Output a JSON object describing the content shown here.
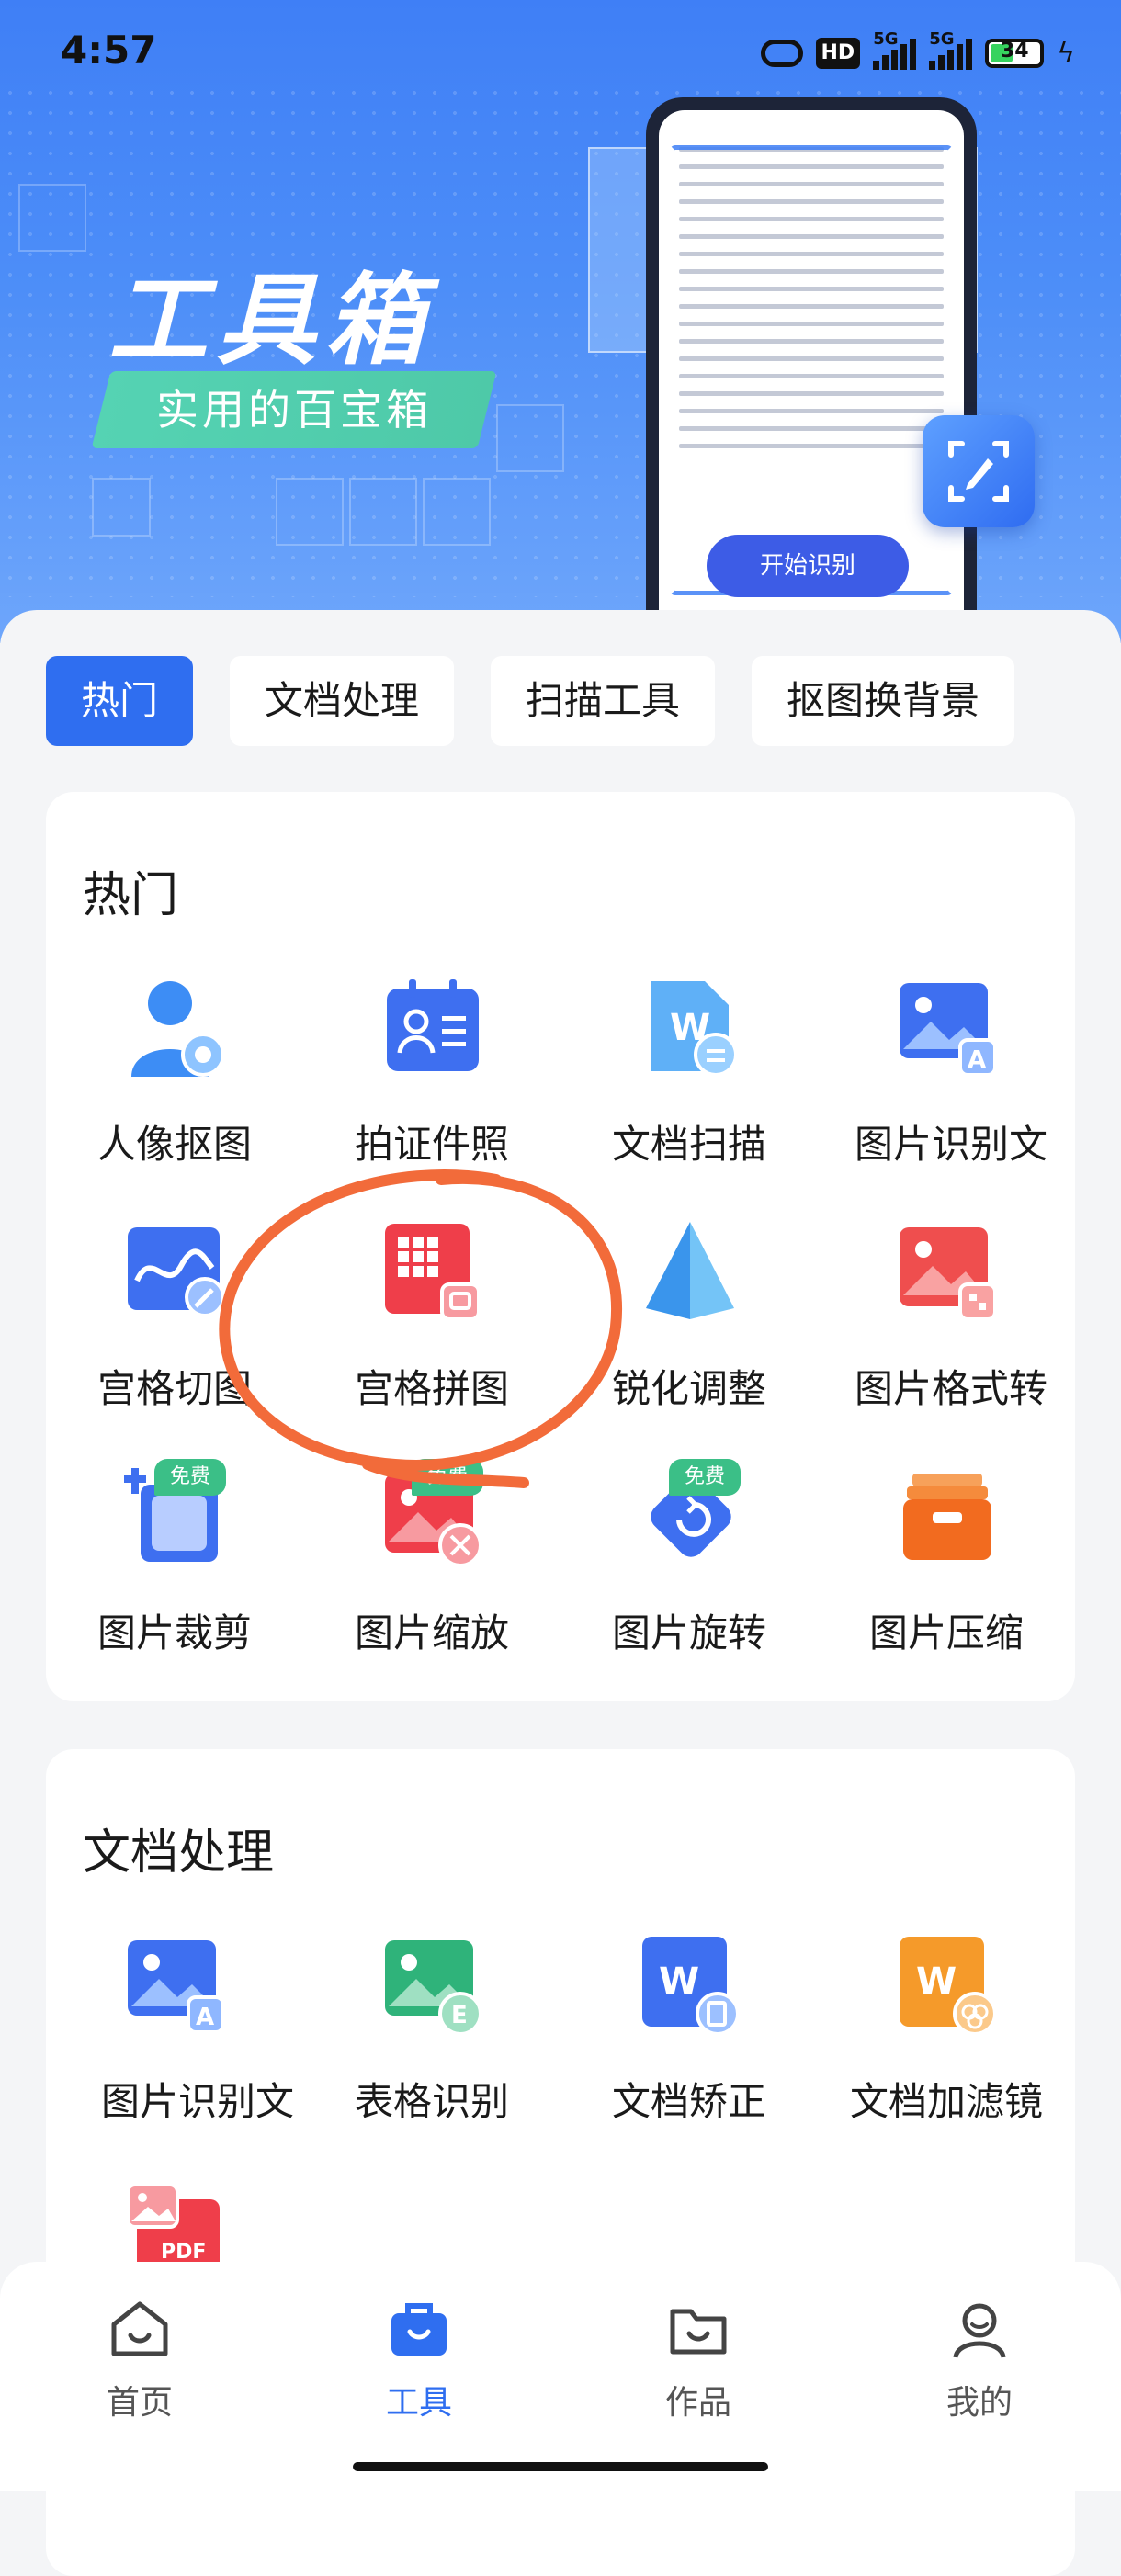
{
  "status_bar": {
    "time": "4:57",
    "hd_label": "HD",
    "network1": "5G",
    "network2": "5G",
    "battery": "34"
  },
  "hero": {
    "title": "工具箱",
    "subtitle": "实用的百宝箱",
    "phone_button": "开始识别"
  },
  "tabs": [
    {
      "label": "热门",
      "active": true
    },
    {
      "label": "文档处理",
      "active": false
    },
    {
      "label": "扫描工具",
      "active": false
    },
    {
      "label": "抠图换背景",
      "active": false
    }
  ],
  "hot": {
    "title": "热门",
    "tools": [
      {
        "label": "人像抠图",
        "icon": "portrait-icon"
      },
      {
        "label": "拍证件照",
        "icon": "id-card-icon"
      },
      {
        "label": "文档扫描",
        "icon": "doc-scan-icon"
      },
      {
        "label": "图片识别文",
        "icon": "image-text-icon"
      },
      {
        "label": "宫格切图",
        "icon": "grid-cut-icon"
      },
      {
        "label": "宫格拼图",
        "icon": "grid-puzzle-icon"
      },
      {
        "label": "锐化调整",
        "icon": "sharpen-icon"
      },
      {
        "label": "图片格式转",
        "icon": "image-format-icon"
      },
      {
        "label": "图片裁剪",
        "icon": "crop-icon",
        "badge": "免费"
      },
      {
        "label": "图片缩放",
        "icon": "resize-icon",
        "badge": "免费"
      },
      {
        "label": "图片旋转",
        "icon": "rotate-icon",
        "badge": "免费"
      },
      {
        "label": "图片压缩",
        "icon": "compress-icon"
      }
    ]
  },
  "docs": {
    "title": "文档处理",
    "tools": [
      {
        "label": "图片识别文",
        "icon": "image-text-icon"
      },
      {
        "label": "表格识别",
        "icon": "table-recognize-icon"
      },
      {
        "label": "文档矫正",
        "icon": "doc-correct-icon"
      },
      {
        "label": "文档加滤镜",
        "icon": "doc-filter-icon"
      },
      {
        "label": "PDF",
        "icon": "image-to-pdf-icon"
      }
    ]
  },
  "nav": [
    {
      "label": "首页",
      "icon": "home-icon",
      "active": false
    },
    {
      "label": "工具",
      "icon": "toolbox-icon",
      "active": true
    },
    {
      "label": "作品",
      "icon": "folder-icon",
      "active": false
    },
    {
      "label": "我的",
      "icon": "profile-icon",
      "active": false
    }
  ],
  "colors": {
    "accent": "#2f6ef0",
    "free_badge": "#3bbf87",
    "annotation": "#f26b3a"
  }
}
